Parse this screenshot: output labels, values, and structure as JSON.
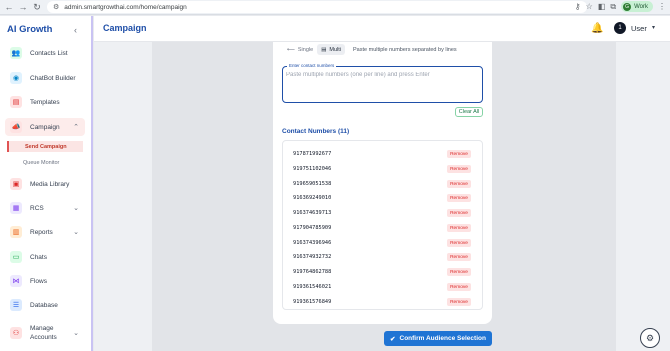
{
  "browser": {
    "url": "admin.smartgrowthai.com/home/campaign",
    "profile_label": "Work",
    "profile_initial": "G"
  },
  "sidebar": {
    "brand": "AI Growth",
    "items": [
      {
        "label": "Contacts List",
        "icon": "contacts-icon",
        "color": "#16a34a",
        "bg": "#dcfce7"
      },
      {
        "label": "ChatBot Builder",
        "icon": "chatbot-icon",
        "color": "#0284c7",
        "bg": "#e0f2fe"
      },
      {
        "label": "Templates",
        "icon": "template-icon",
        "color": "#dc2626",
        "bg": "#fee2e2"
      },
      {
        "label": "Campaign",
        "icon": "megaphone-icon",
        "color": "#dc2626",
        "bg": "#fee2e2"
      },
      {
        "label": "Media Library",
        "icon": "media-icon",
        "color": "#dc2626",
        "bg": "#fee2e2"
      },
      {
        "label": "RCS",
        "icon": "rcs-icon",
        "color": "#7c3aed",
        "bg": "#ede9fe"
      },
      {
        "label": "Reports",
        "icon": "reports-icon",
        "color": "#ea580c",
        "bg": "#ffedd5"
      },
      {
        "label": "Chats",
        "icon": "chat-icon",
        "color": "#16a34a",
        "bg": "#dcfce7"
      },
      {
        "label": "Flows",
        "icon": "flows-icon",
        "color": "#7c3aed",
        "bg": "#ede9fe"
      },
      {
        "label": "Database",
        "icon": "database-icon",
        "color": "#2563eb",
        "bg": "#dbeafe"
      },
      {
        "label": "Manage Accounts",
        "icon": "accounts-icon",
        "color": "#dc2626",
        "bg": "#fee2e2"
      }
    ],
    "sub_items": [
      "Send Campaign",
      "Queue Monitor"
    ]
  },
  "header": {
    "title": "Campaign",
    "user_initial": "1",
    "user_name": "User"
  },
  "form": {
    "mode_single": "Single",
    "mode_multi": "Multi",
    "mode_hint": "Paste multiple numbers separated by lines",
    "field_label": "Enter contact numbers",
    "field_placeholder": "Paste multiple numbers (one per line) and press Enter",
    "clear_all": "Clear All",
    "contacts_heading": "Contact Numbers (11)",
    "remove_label": "Remove",
    "numbers": [
      "917871992677",
      "919751102046",
      "919659051538",
      "916369249010",
      "916374639713",
      "917904785909",
      "916374396946",
      "916374932732",
      "919764862788",
      "919361546021",
      "919361576849"
    ],
    "confirm_label": "Confirm Audience Selection"
  },
  "colors": {
    "brand_blue": "#1f4fa8",
    "confirm_blue": "#1f74d4",
    "remove_red": "#dc2626",
    "active_campaign_bg": "#fdeceb"
  }
}
